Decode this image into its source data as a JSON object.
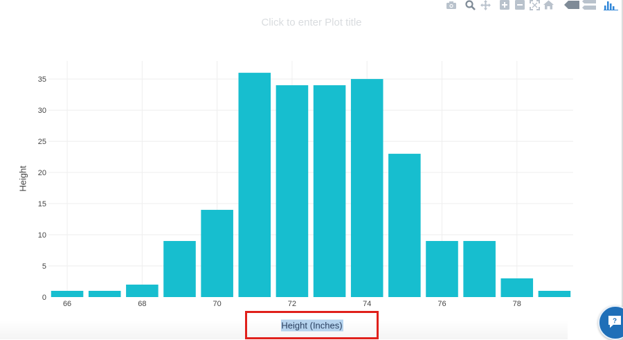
{
  "plot": {
    "title_placeholder": "Click to enter Plot title"
  },
  "colors": {
    "bar": "#17becf",
    "grid": "#eeeeee",
    "tick_text": "#444444",
    "title_placeholder": "#d9dcdf",
    "highlight": "#e0201b",
    "help_button": "#1f6fb8"
  },
  "modebar": {
    "icons": [
      "camera-icon",
      "zoom-icon",
      "pan-icon",
      "zoom-in-icon",
      "zoom-out-icon",
      "autoscale-icon",
      "reset-axes-icon",
      "hover-closest-icon",
      "hover-compare-icon",
      "plotly-logo-icon"
    ]
  },
  "chart_data": {
    "type": "bar",
    "title": "",
    "xlabel": "Height (Inches)",
    "ylabel": "Height",
    "x": [
      66,
      67,
      68,
      69,
      70,
      71,
      72,
      73,
      74,
      75,
      76,
      77,
      78,
      79
    ],
    "values": [
      1,
      1,
      2,
      9,
      14,
      36,
      34,
      34,
      35,
      23,
      9,
      9,
      3,
      1
    ],
    "xlim": [
      65.5,
      79.5
    ],
    "ylim": [
      0,
      37.9
    ],
    "xticks": [
      66,
      68,
      70,
      72,
      74,
      76,
      78
    ],
    "yticks": [
      0,
      5,
      10,
      15,
      20,
      25,
      30,
      35
    ],
    "grid": true,
    "legend": "none"
  },
  "help": {
    "icon": "help-chat-icon"
  }
}
